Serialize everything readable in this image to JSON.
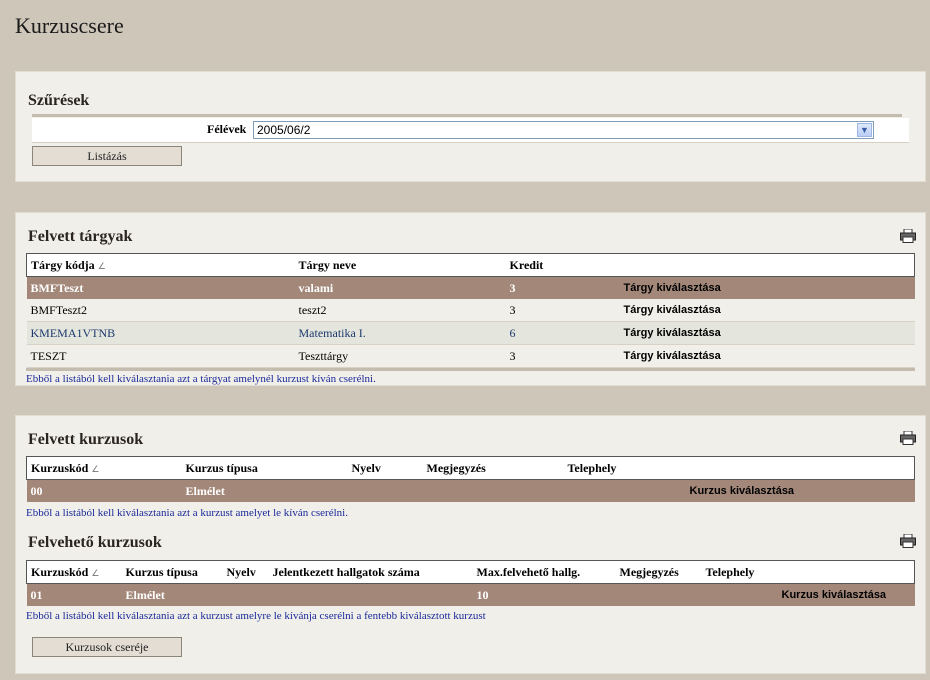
{
  "page": {
    "title": "Kurzuscsere"
  },
  "filters": {
    "title": "Szűrések",
    "semester_label": "Félévek",
    "semester_value": "2005/06/2",
    "list_button": "Listázás"
  },
  "subjects": {
    "title": "Felvett tárgyak",
    "columns": [
      "Tárgy kódja",
      "Tárgy neve",
      "Kredit",
      ""
    ],
    "rows": [
      {
        "code": "BMFTeszt",
        "name": "valami",
        "credit": "3",
        "action": "Tárgy kiválasztása"
      },
      {
        "code": "BMFTeszt2",
        "name": "teszt2",
        "credit": "3",
        "action": "Tárgy kiválasztása"
      },
      {
        "code": "KMEMA1VTNB",
        "name": "Matematika I.",
        "credit": "6",
        "action": "Tárgy kiválasztása"
      },
      {
        "code": "TESZT",
        "name": "Teszttárgy",
        "credit": "3",
        "action": "Tárgy kiválasztása"
      }
    ],
    "hint": "Ebből a listából kell kiválasztania azt a tárgyat amelynél kurzust kíván cserélni."
  },
  "taken_courses": {
    "title": "Felvett kurzusok",
    "columns": [
      "Kurzuskód",
      "Kurzus típusa",
      "Nyelv",
      "Megjegyzés",
      "Telephely",
      ""
    ],
    "rows": [
      {
        "code": "00",
        "type": "Elmélet",
        "lang": "",
        "note": "",
        "site": "",
        "action": "Kurzus kiválasztása"
      }
    ],
    "hint": "Ebből a listából kell kiválasztania azt a kurzust amelyet le kíván cserélni."
  },
  "available_courses": {
    "title": "Felvehető kurzusok",
    "columns": [
      "Kurzuskód",
      "Kurzus típusa",
      "Nyelv",
      "Jelentkezett hallgatok száma",
      "Max.felvehető hallg.",
      "Megjegyzés",
      "Telephely",
      ""
    ],
    "rows": [
      {
        "code": "01",
        "type": "Elmélet",
        "lang": "",
        "applied": "",
        "max": "10",
        "note": "",
        "site": "",
        "action": "Kurzus kiválasztása"
      }
    ],
    "hint": "Ebből a listából kell kiválasztania azt a kurzust amelyre le kívánja cserélni a fentebb kiválasztott kurzust",
    "swap_button": "Kurzusok cseréje"
  },
  "icons": {
    "print": "printer-icon",
    "sort": "sort-ascending-icon"
  },
  "colors": {
    "selected_row": "#a3887a",
    "background": "#cdc6b9",
    "panel": "#f1efe9",
    "link_text": "#1a2a9a"
  }
}
